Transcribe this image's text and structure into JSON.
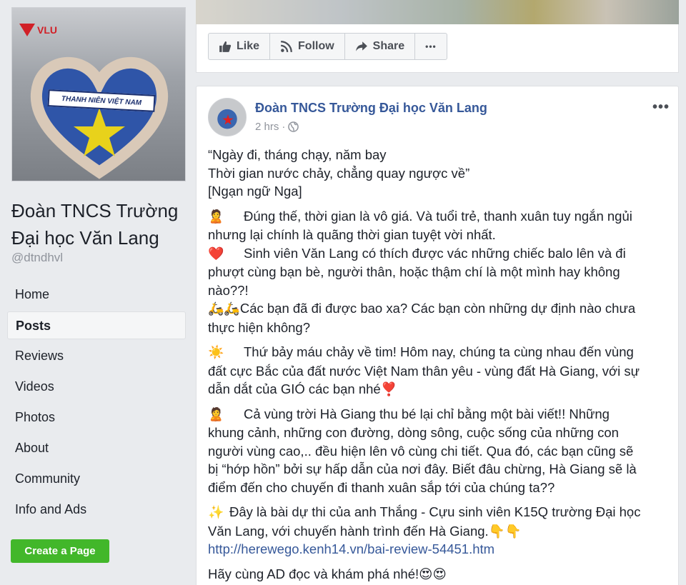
{
  "left": {
    "logo_text": "VLU",
    "banner_text": "THANH NIÊN VIỆT NAM",
    "page_name": "Đoàn TNCS Trường Đại học Văn Lang",
    "handle": "@dtndhvl",
    "nav": [
      "Home",
      "Posts",
      "Reviews",
      "Videos",
      "Photos",
      "About",
      "Community",
      "Info and Ads"
    ],
    "active_nav": "Posts",
    "create_page": "Create a Page"
  },
  "actions": {
    "like": "Like",
    "follow": "Follow",
    "share": "Share",
    "more": "•••"
  },
  "post": {
    "author": "Đoàn TNCS Trường Đại học Văn Lang",
    "time": "2 hrs",
    "separator": "·",
    "more": "•••",
    "quote": [
      "“Ngày đi, tháng chạy, năm bay",
      "Thời gian nước chảy, chẳng quay ngược về”",
      "[Ngạn ngữ Nga]"
    ],
    "p1": {
      "emoji1": "🙎",
      "l1": "Đúng thế, thời gian là vô giá. Và tuổi trẻ, thanh xuân tuy ngắn ngủi",
      "l2": "nhưng lại chính là quãng thời gian tuyệt vời nhất.",
      "emoji2": "❤️",
      "l3": "Sinh viên Văn Lang có thích được vác những chiếc balo lên và đi",
      "l4": "phượt cùng bạn bè, người thân, hoặc thậm chí là một mình hay không",
      "l5": "nào??!",
      "emoji3": "🛵🛵",
      "l6": "Các bạn đã đi được bao xa? Các bạn còn những dự định nào chưa",
      "l7": "thực hiện không?"
    },
    "p2": {
      "emoji": "☀️",
      "l1": "Thứ bảy máu chảy về tim! Hôm nay, chúng ta cùng nhau đến vùng",
      "l2": "đất cực Bắc của đất nước Việt Nam thân yêu - vùng đất Hà Giang, với sự",
      "l3": "dẫn dắt của GIÓ các bạn nhé",
      "emoji_end": "❣️"
    },
    "p3": {
      "emoji": "🙎",
      "l1": "Cả vùng trời Hà Giang thu bé lại chỉ bằng một bài viết!! Những",
      "l2": "khung cảnh, những con đường, dòng sông, cuộc sống của những con",
      "l3": "người vùng cao,.. đều hiện lên vô cùng chi tiết. Qua đó, các bạn cũng sẽ",
      "l4": "bị “hớp hồn” bởi sự hấp dẫn của nơi đây. Biết đâu chừng, Hà Giang sẽ là",
      "l5": "điểm đến cho chuyến đi thanh xuân sắp tới của chúng ta??"
    },
    "p4": {
      "emoji": "✨",
      "l1": "Đây là bài dự thi của anh Thắng - Cựu sinh viên K15Q trường Đại học",
      "l2": "Văn Lang, với chuyến hành trình đến Hà Giang.",
      "emoji_end": "👇👇",
      "link": "http://herewego.kenh14.vn/bai-review-54451.htm"
    },
    "p5": {
      "text": "Hãy cùng AD đọc và khám phá nhé!",
      "emoji_end": "😍😍"
    }
  }
}
